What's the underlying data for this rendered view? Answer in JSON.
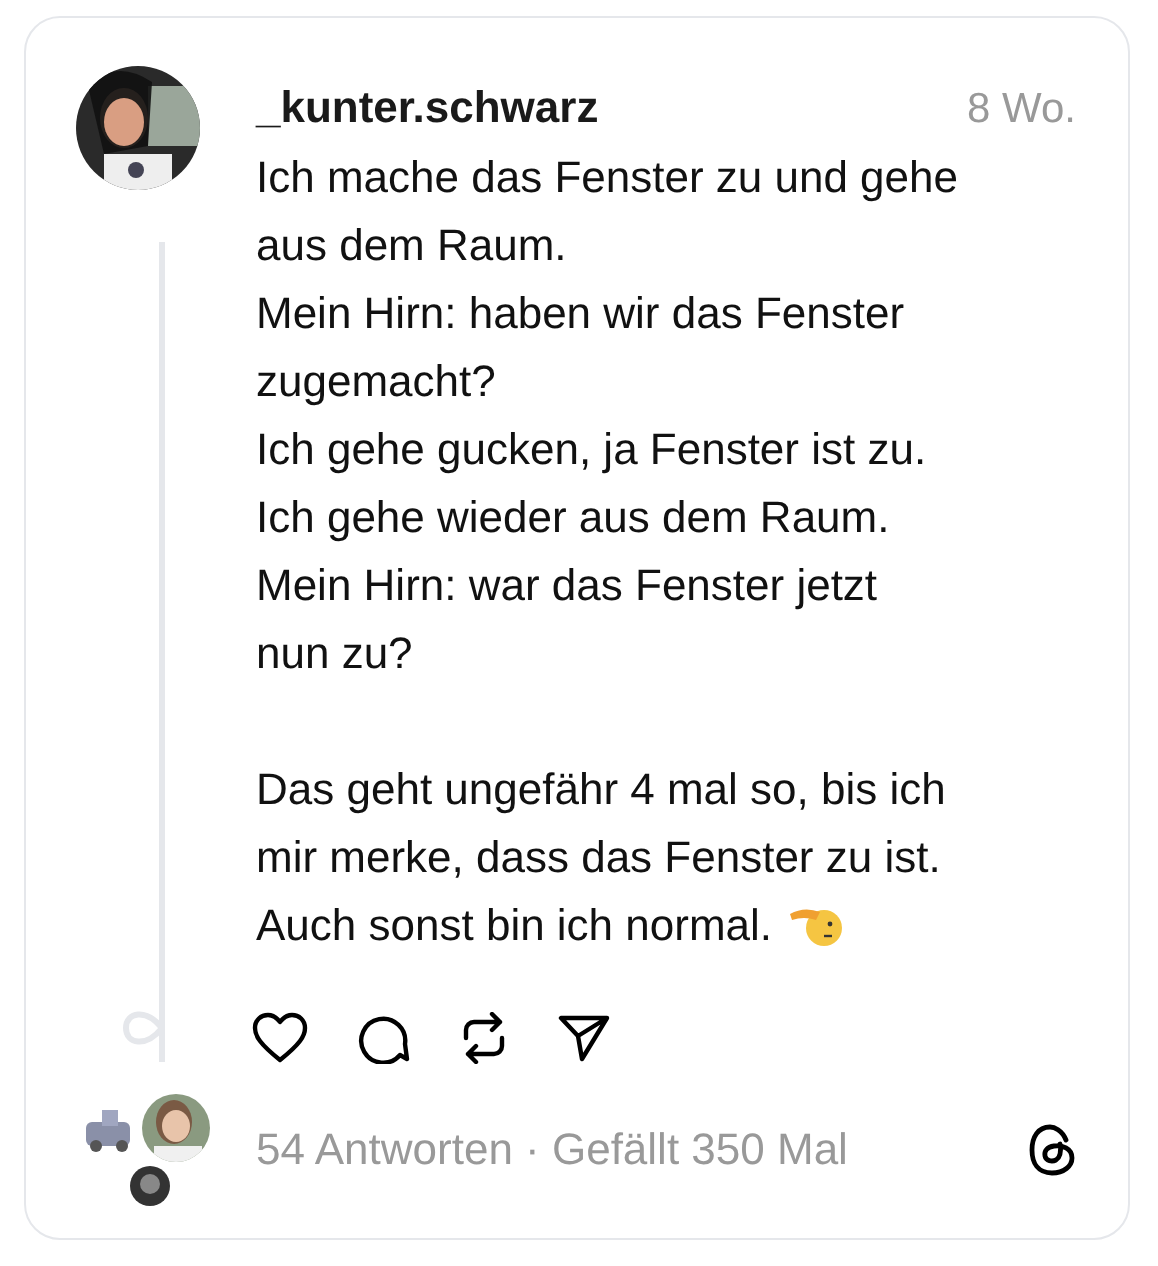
{
  "post": {
    "username": "_kunter.schwarz",
    "time": "8 Wo.",
    "blocks": [
      [
        "Ich mache das Fenster zu und gehe aus dem Raum.",
        "Mein Hirn: haben wir das Fenster zugemacht?",
        "Ich gehe gucken, ja Fenster ist zu.",
        "Ich gehe wieder aus dem Raum.",
        "Mein Hirn: war das Fenster jetzt nun zu?"
      ],
      [
        "Das geht ungefähr 4 mal so, bis ich mir merke, dass das Fenster zu ist.",
        "Auch sonst bin ich normal."
      ]
    ],
    "stats": "54 Antworten · Gefällt 350 Mal"
  }
}
